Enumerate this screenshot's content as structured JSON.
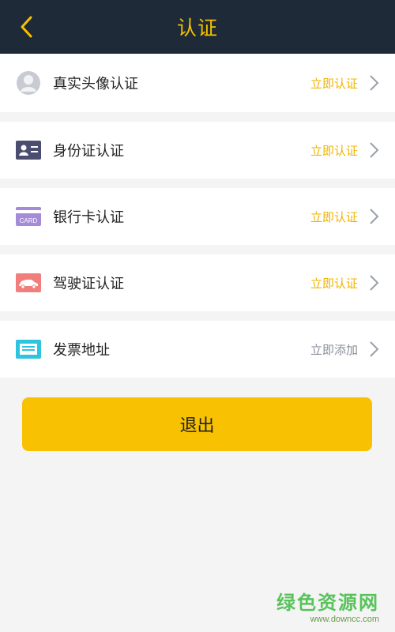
{
  "header": {
    "title": "认证"
  },
  "rows": [
    {
      "label": "真实头像认证",
      "action": "立即认证",
      "action_color": "#f1b400",
      "icon": "avatar-icon"
    },
    {
      "label": "身份证认证",
      "action": "立即认证",
      "action_color": "#f1b400",
      "icon": "id-card-icon"
    },
    {
      "label": "银行卡认证",
      "action": "立即认证",
      "action_color": "#f1b400",
      "icon": "bank-card-icon"
    },
    {
      "label": "驾驶证认证",
      "action": "立即认证",
      "action_color": "#f1b400",
      "icon": "car-license-icon"
    },
    {
      "label": "发票地址",
      "action": "立即添加",
      "action_color": "#8a8f99",
      "icon": "invoice-icon"
    }
  ],
  "logout_label": "退出",
  "watermark": {
    "main": "绿色资源网",
    "sub": "www.downcc.com"
  },
  "colors": {
    "header_bg": "#1e2a37",
    "accent": "#f6c200",
    "button": "#f8c102"
  }
}
